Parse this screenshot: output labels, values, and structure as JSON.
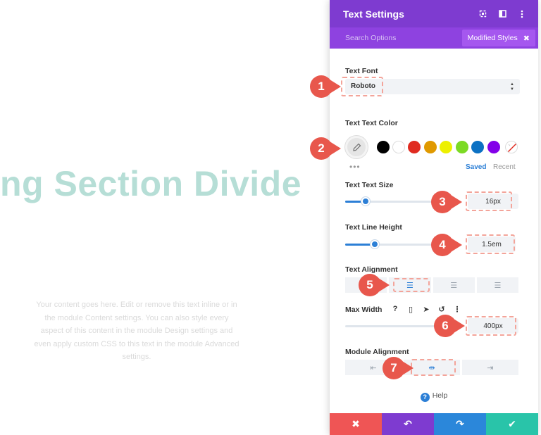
{
  "canvas": {
    "heading": "ng Section Divide",
    "body_text": "Your content goes here. Edit or remove this text inline or in the module Content settings. You can also style every aspect of this content in the module Design settings and even apply custom CSS to this text in the module Advanced settings."
  },
  "modal": {
    "title": "Text Settings",
    "header_icons": [
      "fullscreen-icon",
      "sidebar-icon",
      "more-vertical-icon"
    ],
    "search_placeholder": "Search Options",
    "modified_styles_label": "Modified Styles",
    "modified_styles_close": "✖"
  },
  "text_font": {
    "label": "Text Font",
    "value": "Roboto",
    "arrows": "▲▼"
  },
  "text_color": {
    "label": "Text Text Color",
    "picker_icon": "eyedropper-icon",
    "swatches": [
      "#000000",
      "#ffffff",
      "#e02b20",
      "#e09900",
      "#edf000",
      "#7cda24",
      "#0c71c3",
      "#8300e9",
      "transparent"
    ],
    "more": "•••",
    "saved": "Saved",
    "recent": "Recent"
  },
  "text_size": {
    "label": "Text Text Size",
    "value": "16px",
    "slider_fraction": 0.18
  },
  "line_height": {
    "label": "Text Line Height",
    "value": "1.5em",
    "slider_fraction": 0.26
  },
  "text_alignment": {
    "label": "Text Alignment",
    "options": [
      "align-left-icon",
      "align-center-icon",
      "align-right-icon",
      "align-justify-icon"
    ],
    "glyphs": [
      "☰",
      "☰",
      "☰",
      "☰"
    ],
    "active_index": 1
  },
  "max_width": {
    "label": "Max Width",
    "icons": [
      "help-icon",
      "phone-icon",
      "cursor-icon",
      "reset-icon",
      "more-vertical-icon"
    ],
    "icon_glyphs": [
      "?",
      "▯",
      "➤",
      "↺",
      "⋮"
    ],
    "value": "400px"
  },
  "module_alignment": {
    "label": "Module Alignment",
    "options": [
      "module-left-icon",
      "module-center-icon",
      "module-right-icon"
    ],
    "glyphs": [
      "⇤",
      "⇹",
      "⇥"
    ],
    "active_index": 1
  },
  "help": {
    "label": "Help",
    "glyph": "?"
  },
  "footer": {
    "buttons": [
      {
        "name": "cancel-button",
        "glyph": "✖",
        "color": "#ef5555"
      },
      {
        "name": "undo-button",
        "glyph": "↶",
        "color": "#7e3bd0"
      },
      {
        "name": "redo-button",
        "glyph": "↷",
        "color": "#2b87da"
      },
      {
        "name": "save-button",
        "glyph": "✔",
        "color": "#29c4a9"
      }
    ]
  },
  "callouts": [
    "1",
    "2",
    "3",
    "4",
    "5",
    "6",
    "7"
  ],
  "colors": {
    "accent": "#7e3bd0",
    "callout": "#e8574c",
    "highlight": "#f3a49a",
    "blue": "#2c7fd6"
  }
}
